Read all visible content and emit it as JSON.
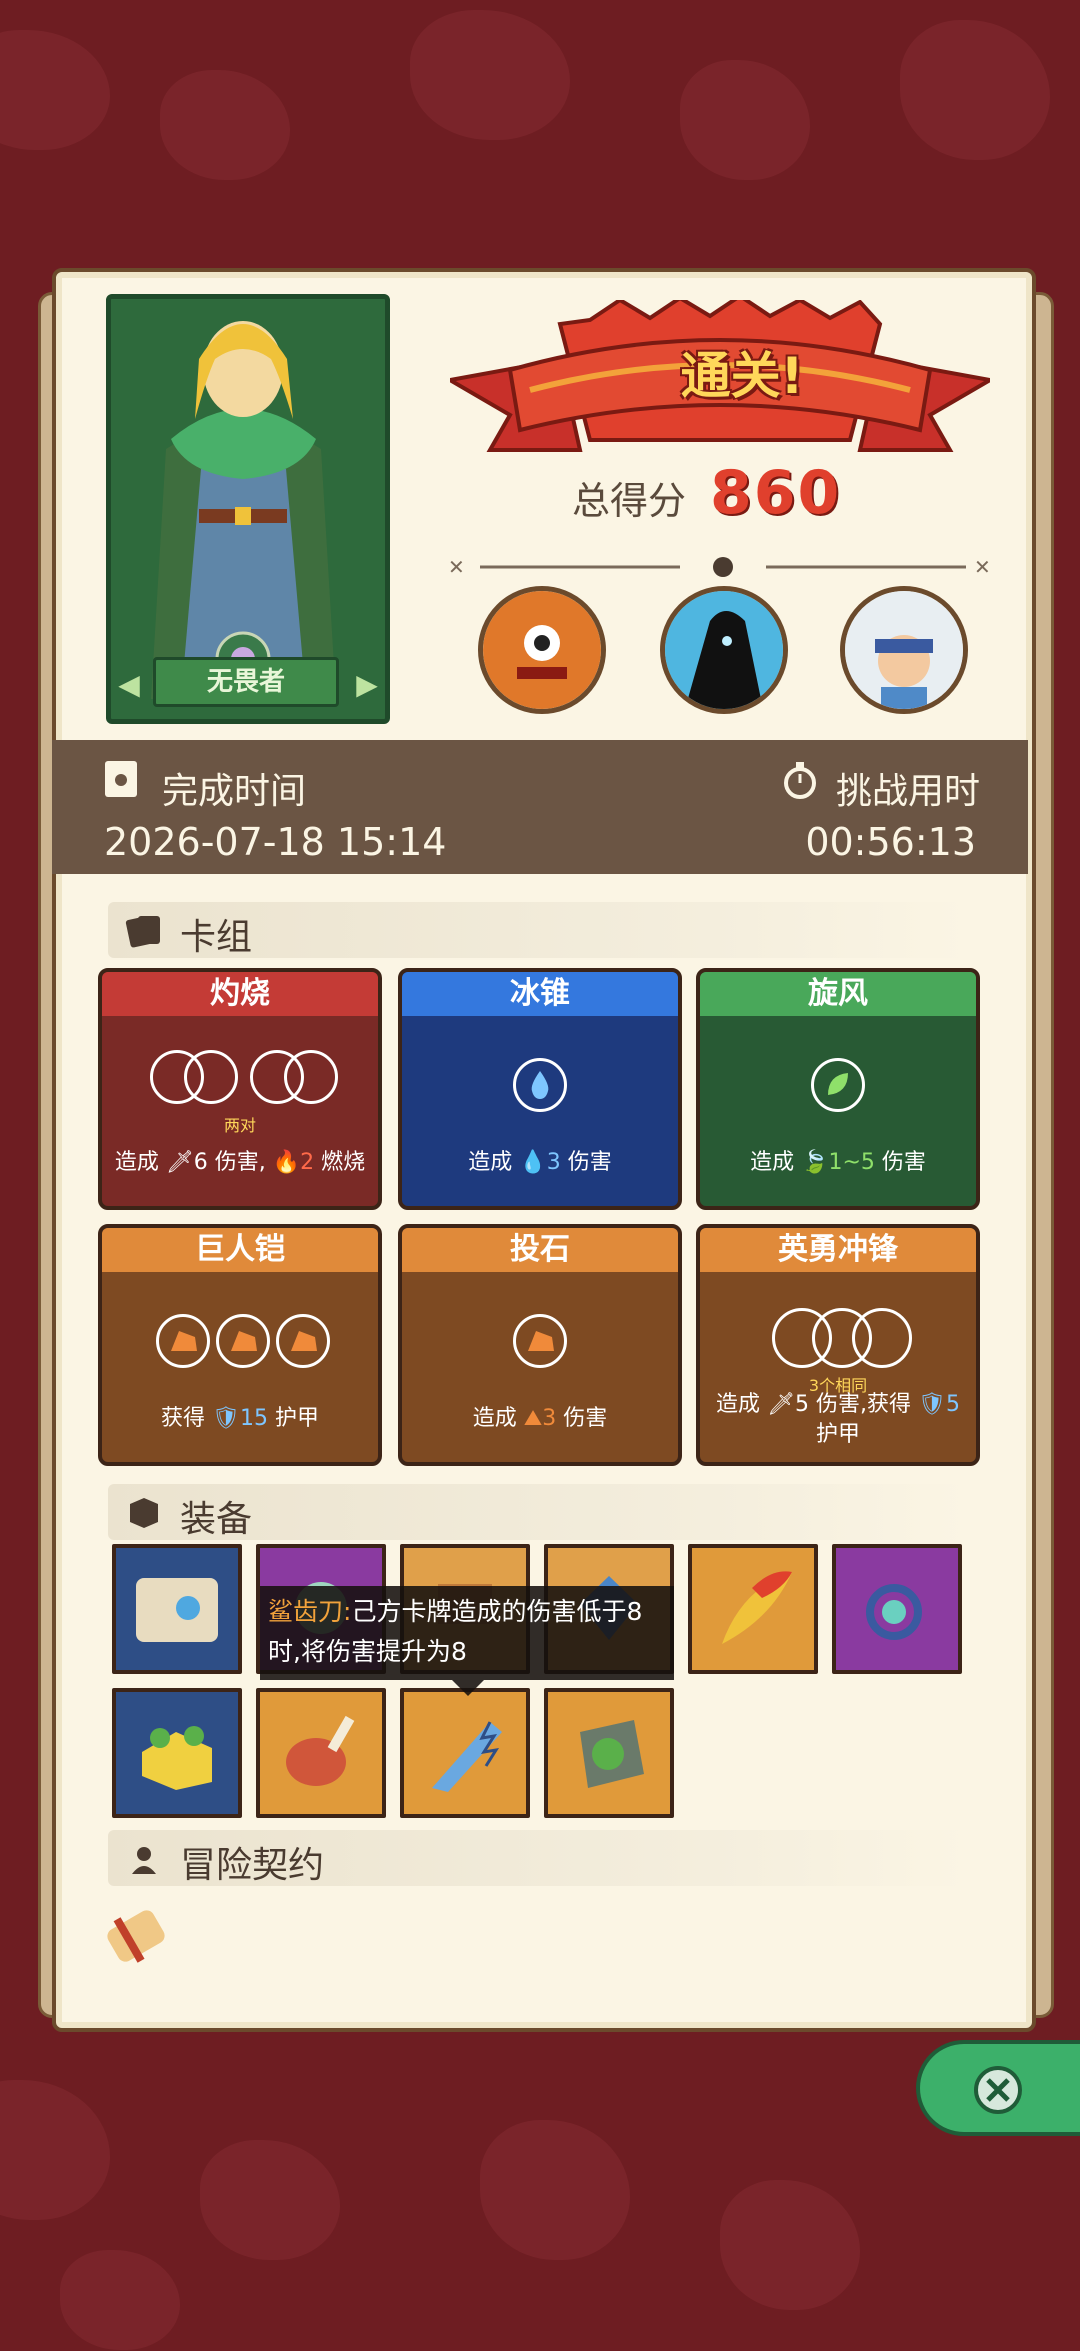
{
  "hero": {
    "name": "无畏者"
  },
  "result": {
    "title": "通关!"
  },
  "score": {
    "label": "总得分",
    "value": "860"
  },
  "info": {
    "finish_time_label": "完成时间",
    "finish_time_value": "2026-07-18 15:14",
    "duration_label": "挑战用时",
    "duration_value": "00:56:13"
  },
  "deck": {
    "header": "卡组",
    "cards": [
      {
        "title": "灼烧",
        "color": "red",
        "sub": "两对",
        "desc_pre": "造成",
        "v1": "6",
        "mid": "伤害,",
        "v2": "2",
        "desc_post": "燃烧"
      },
      {
        "title": "冰锥",
        "color": "blue",
        "desc_pre": "造成",
        "v1": "3",
        "desc_post": "伤害"
      },
      {
        "title": "旋风",
        "color": "green",
        "desc_pre": "造成",
        "v1": "1~5",
        "desc_post": "伤害"
      },
      {
        "title": "巨人铠",
        "color": "orange",
        "desc_pre": "获得",
        "v1": "15",
        "desc_post": "护甲"
      },
      {
        "title": "投石",
        "color": "orange",
        "desc_pre": "造成",
        "v1": "3",
        "desc_post": "伤害"
      },
      {
        "title": "英勇冲锋",
        "color": "orange",
        "sub": "3个相同",
        "desc_pre": "造成",
        "v1": "5",
        "mid": "伤害,获得",
        "v2": "5",
        "desc_post": "护甲"
      }
    ]
  },
  "equipment": {
    "header": "装备",
    "items": [
      "scroll-icon",
      "gem-orb-icon",
      "treasure-icon",
      "crystal-icon",
      "fire-feather-icon",
      "amulet-icon",
      "cheese-icon",
      "meat-icon",
      "shark-tooth-knife-icon",
      "moss-stone-icon"
    ],
    "tooltip": {
      "name": "鲨齿刀:",
      "text": "己方卡牌造成的伤害低于8时,将伤害提升为8"
    }
  },
  "contract": {
    "header": "冒险契约"
  },
  "colors": {
    "accent": "#e0402d",
    "red": "#b6312f",
    "blue": "#2e64c8",
    "green": "#3a9a4a",
    "orange": "#e08a3a"
  }
}
